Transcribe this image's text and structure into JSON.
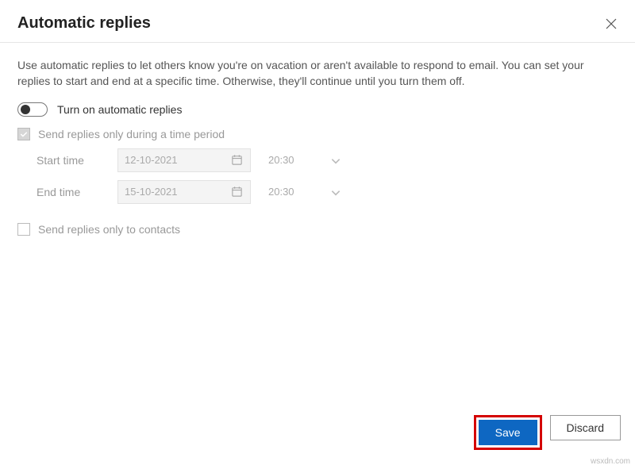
{
  "header": {
    "title": "Automatic replies"
  },
  "description": "Use automatic replies to let others know you're on vacation or aren't available to respond to email. You can set your replies to start and end at a specific time. Otherwise, they'll continue until you turn them off.",
  "toggle": {
    "label": "Turn on automatic replies"
  },
  "time_period": {
    "label": "Send replies only during a time period",
    "start_label": "Start time",
    "start_date": "12-10-2021",
    "start_time": "20:30",
    "end_label": "End time",
    "end_date": "15-10-2021",
    "end_time": "20:30"
  },
  "contacts_only": {
    "label": "Send replies only to contacts"
  },
  "footer": {
    "save": "Save",
    "discard": "Discard"
  },
  "credit": "wsxdn.com"
}
